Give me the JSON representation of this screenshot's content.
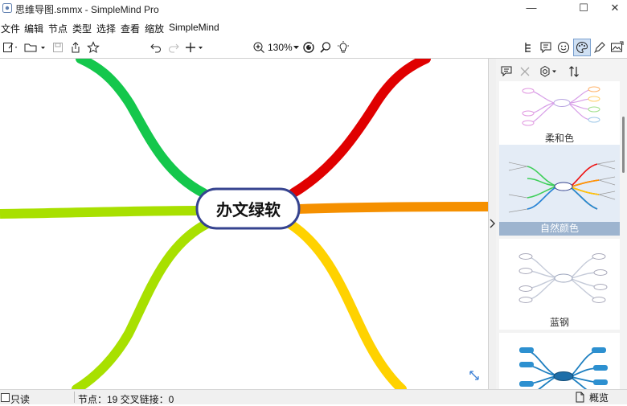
{
  "window": {
    "title": "思维导图.smmx - SimpleMind Pro",
    "minimize": "—",
    "maximize": "☐",
    "close": "✕"
  },
  "menu": [
    "文件",
    "编辑",
    "节点",
    "类型",
    "选择",
    "查看",
    "缩放",
    "SimpleMind"
  ],
  "toolbar": {
    "zoom": "130%",
    "icons": [
      "new-icon",
      "open-icon",
      "save-icon",
      "share-icon",
      "favorite-icon",
      "undo-icon",
      "redo-icon",
      "add-icon",
      "zoom-in-icon",
      "focus-icon",
      "search-icon",
      "idea-icon",
      "layout-icon",
      "notes-icon",
      "emoji-icon",
      "style-icon",
      "pen-icon",
      "image-icon"
    ]
  },
  "mindmap": {
    "central_topic": "办文绿软",
    "branch_colors": [
      "#14c74c",
      "#e00000",
      "#f59000",
      "#ffd200",
      "#a8e000",
      "#a8e000"
    ],
    "node_border": "#35438f"
  },
  "panel": {
    "styles": [
      {
        "name": "柔和色",
        "selected": false
      },
      {
        "name": "自然颜色",
        "selected": true
      },
      {
        "name": "蓝钢",
        "selected": false
      },
      {
        "name": "",
        "selected": false
      }
    ]
  },
  "statusbar": {
    "readonly": "只读",
    "stats": "节点：19 交叉链接：0",
    "overview": "概览"
  }
}
